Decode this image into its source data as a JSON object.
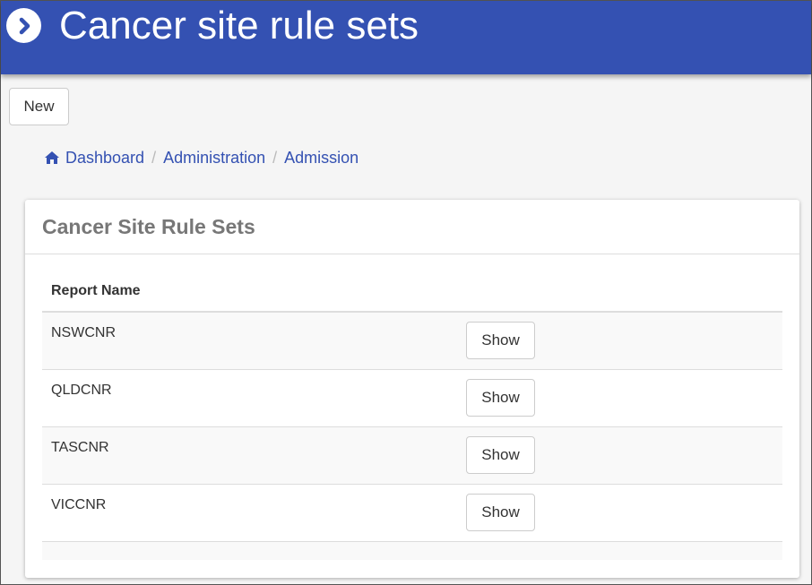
{
  "header": {
    "title": "Cancer site rule sets",
    "icon": "chevron-right-circle-icon",
    "bg_color": "#3451b2"
  },
  "toolbar": {
    "new_label": "New"
  },
  "breadcrumb": {
    "items": [
      "Dashboard",
      "Administration",
      "Admission"
    ],
    "home_icon": "home-icon"
  },
  "card": {
    "title": "Cancer Site Rule Sets",
    "table": {
      "columns": [
        "Report Name"
      ],
      "rows": [
        {
          "name": "NSWCNR",
          "action": "Show"
        },
        {
          "name": "QLDCNR",
          "action": "Show"
        },
        {
          "name": "TASCNR",
          "action": "Show"
        },
        {
          "name": "VICCNR",
          "action": "Show"
        }
      ]
    }
  }
}
